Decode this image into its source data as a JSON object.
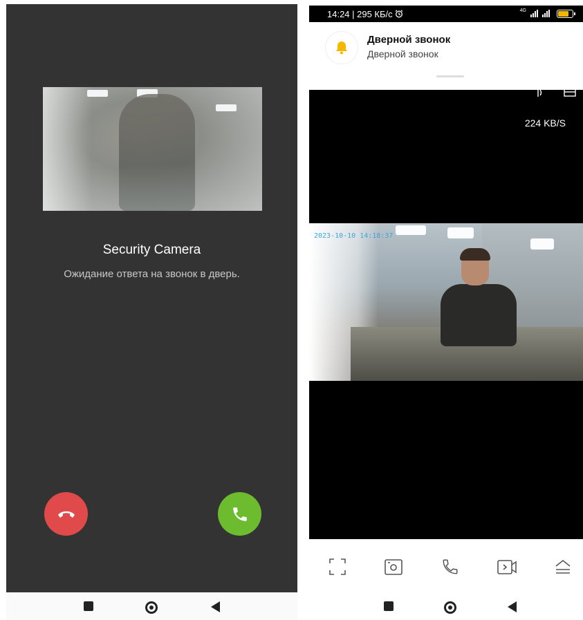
{
  "left_screen": {
    "caller_name": "Security Camera",
    "status_text": "Ожидание ответа на звонок в дверь."
  },
  "right_screen": {
    "status_bar": {
      "time_and_speed": "14:24 | 295 КБ/с",
      "network_label": "4G",
      "battery_color": "#f3b400"
    },
    "notification": {
      "title": "Дверной звонок",
      "body": "Дверной звонок",
      "icon": "bell-icon",
      "icon_color": "#f5b800"
    },
    "stream_speed": "224 KB/S",
    "camera_timestamp": "2023-10-10  14:18:37",
    "toolbar_icons": [
      "fullscreen-icon",
      "snapshot-icon",
      "call-icon",
      "record-icon",
      "more-icon"
    ]
  },
  "colors": {
    "decline": "#e04a4a",
    "accept": "#6dbb2f",
    "call_background": "#333333"
  }
}
